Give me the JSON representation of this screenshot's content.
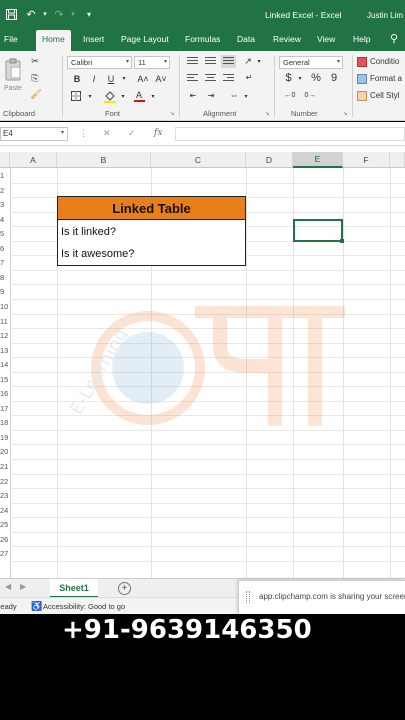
{
  "titlebar": {
    "doc_title": "Linked Excel  -  Excel",
    "user": "Justin Lim"
  },
  "tabs": [
    "File",
    "Home",
    "Insert",
    "Page Layout",
    "Formulas",
    "Data",
    "Review",
    "View",
    "Help"
  ],
  "active_tab": "Home",
  "ribbon": {
    "clipboard": {
      "paste_label": "Paste",
      "group_label": "Clipboard"
    },
    "font": {
      "name": "Calibri",
      "size": "11",
      "bold": "B",
      "italic": "I",
      "underline": "U",
      "grow": "A˄",
      "shrink": "A˅",
      "color_letter": "A",
      "group_label": "Font"
    },
    "alignment": {
      "group_label": "Alignment"
    },
    "number": {
      "format": "General",
      "currency": "$",
      "percent": "%",
      "comma": "9",
      "group_label": "Number"
    },
    "styles": {
      "conditional": "Conditio",
      "format_as": "Format a",
      "cell_styles": "Cell Styl"
    }
  },
  "formula_bar": {
    "name_box": "E4",
    "fx": "fx",
    "cancel": "✕",
    "enter": "✓",
    "value": ""
  },
  "columns": [
    "A",
    "B",
    "C",
    "D",
    "E",
    "F"
  ],
  "selected_column": "E",
  "rows": [
    "1",
    "2",
    "3",
    "4",
    "5",
    "6",
    "7",
    "8",
    "9",
    "10",
    "11",
    "12",
    "13",
    "14",
    "15",
    "16",
    "17",
    "18",
    "19",
    "20",
    "21",
    "22",
    "23",
    "24",
    "25",
    "26",
    "27"
  ],
  "table": {
    "header": "Linked Table",
    "rows": [
      "Is it linked?",
      "Is it awesome?"
    ]
  },
  "sheet_tabs": [
    "Sheet1"
  ],
  "statusbar": {
    "ready": "Ready",
    "accessibility": "Accessibility: Good to go"
  },
  "share_notice": "app.clipchamp.com is sharing your screen.",
  "overlay_phone": "+91-9639146350",
  "watermark_text": "E-Learning",
  "colors": {
    "excel_green": "#217346",
    "table_header": "#e97f1a",
    "watermark": "#f4a06a"
  }
}
